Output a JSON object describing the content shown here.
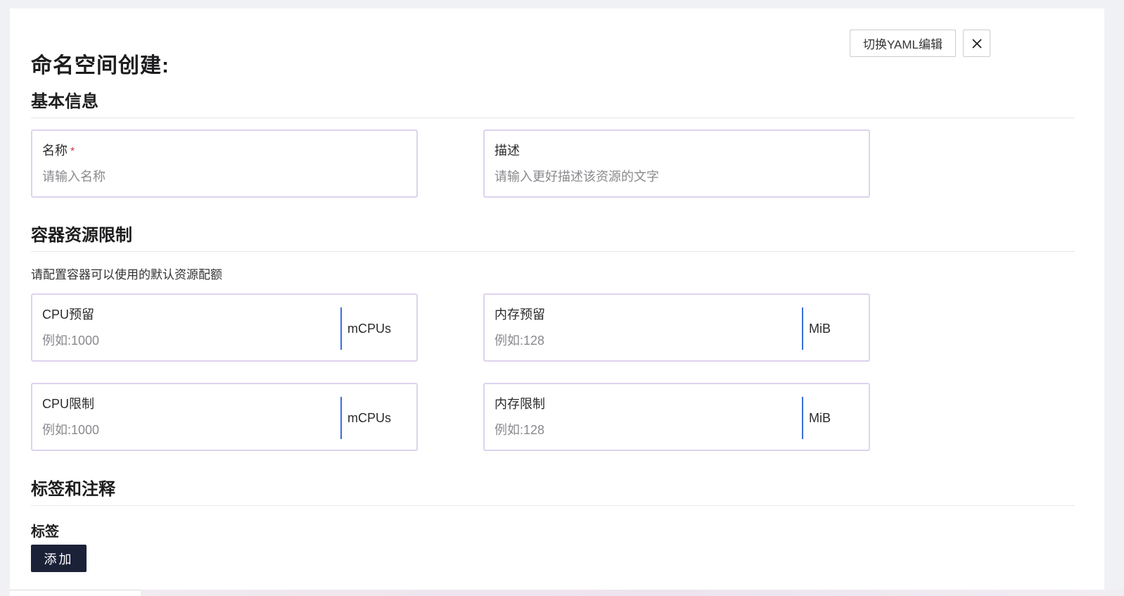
{
  "header": {
    "title": "命名空间创建:",
    "yaml_button_label": "切换YAML编辑",
    "close_icon": "close-icon"
  },
  "basic_info": {
    "section_title": "基本信息",
    "name_field": {
      "label": "名称",
      "required_mark": "*",
      "placeholder": "请输入名称",
      "value": ""
    },
    "desc_field": {
      "label": "描述",
      "placeholder": "请输入更好描述该资源的文字",
      "value": ""
    }
  },
  "resource_limits": {
    "section_title": "容器资源限制",
    "hint": "请配置容器可以使用的默认资源配额",
    "cpu_reserve": {
      "label": "CPU预留",
      "placeholder": "例如:1000",
      "unit": "mCPUs",
      "value": ""
    },
    "mem_reserve": {
      "label": "内存预留",
      "placeholder": "例如:128",
      "unit": "MiB",
      "value": ""
    },
    "cpu_limit": {
      "label": "CPU限制",
      "placeholder": "例如:1000",
      "unit": "mCPUs",
      "value": ""
    },
    "mem_limit": {
      "label": "内存限制",
      "placeholder": "例如:128",
      "unit": "MiB",
      "value": ""
    }
  },
  "labels_annotations": {
    "section_title": "标签和注释",
    "labels_title": "标签",
    "add_button_label": "添加"
  },
  "colors": {
    "field_border": "#ddd3ee",
    "unit_separator": "#3a6fd8",
    "primary_button": "#1b2238",
    "required": "#d9363e"
  }
}
